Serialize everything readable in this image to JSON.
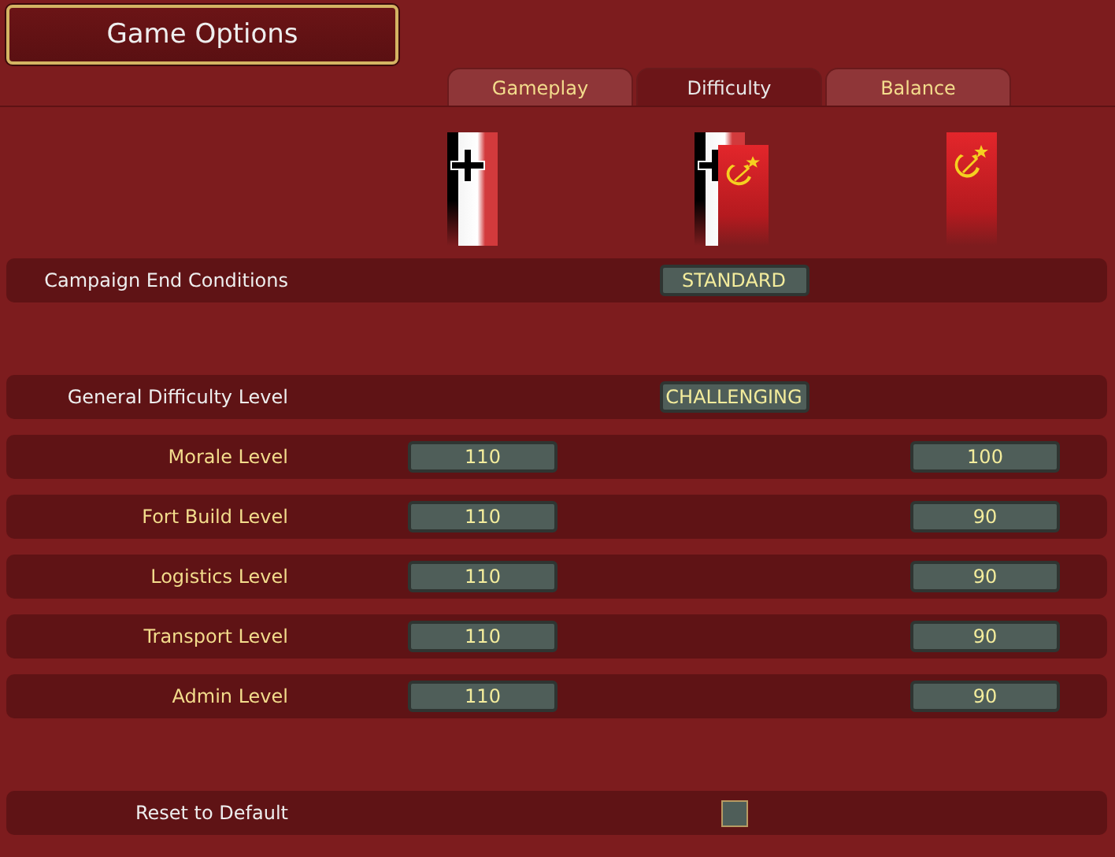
{
  "title": "Game Options",
  "tabs": [
    {
      "label": "Gameplay",
      "selected": false
    },
    {
      "label": "Difficulty",
      "selected": true
    },
    {
      "label": "Balance",
      "selected": false
    }
  ],
  "groups": [
    [
      {
        "kind": "choice",
        "label": "Campaign End Conditions",
        "value": "STANDARD"
      }
    ],
    [
      {
        "kind": "choice",
        "label": "General Difficulty Level",
        "value": "CHALLENGING"
      },
      {
        "kind": "level",
        "label": "Morale Level",
        "german_value": "110",
        "soviet_value": "100"
      },
      {
        "kind": "level",
        "label": "Fort Build Level",
        "german_value": "110",
        "soviet_value": "90"
      },
      {
        "kind": "level",
        "label": "Logistics Level",
        "german_value": "110",
        "soviet_value": "90"
      },
      {
        "kind": "level",
        "label": "Transport Level",
        "german_value": "110",
        "soviet_value": "90"
      },
      {
        "kind": "level",
        "label": "Admin Level",
        "german_value": "110",
        "soviet_value": "90"
      }
    ],
    [
      {
        "kind": "checkbox",
        "label": "Reset to Default",
        "checked": false
      }
    ]
  ]
}
